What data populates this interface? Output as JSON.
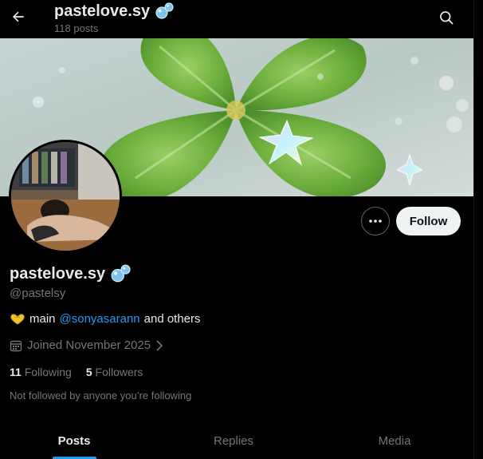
{
  "header": {
    "title": "pastelove.sy",
    "posts_count": "118 posts"
  },
  "profile": {
    "display_name": "pastelove.sy",
    "handle": "@pastelsy",
    "bio_prefix": "main",
    "bio_mention": "@sonyasarann",
    "bio_suffix": "and others",
    "joined": "Joined November 2025",
    "following_count": "11",
    "following_label": "Following",
    "followers_count": "5",
    "followers_label": "Followers",
    "not_followed_text": "Not followed by anyone you’re following"
  },
  "buttons": {
    "follow_label": "Follow"
  },
  "tabs": [
    {
      "label": "Posts",
      "active": true
    },
    {
      "label": "Replies",
      "active": false
    },
    {
      "label": "Media",
      "active": false
    }
  ],
  "colors": {
    "accent": "#1d9bf0",
    "background": "#000000",
    "follow_button_bg": "#eff3f4",
    "muted_text": "#71767b"
  },
  "icons": {
    "back": "arrow-left-icon",
    "search": "search-icon",
    "more": "more-dots-icon",
    "badge": "bubbles-icon",
    "bio_emoji": "heart-hands-icon",
    "calendar": "calendar-icon"
  }
}
